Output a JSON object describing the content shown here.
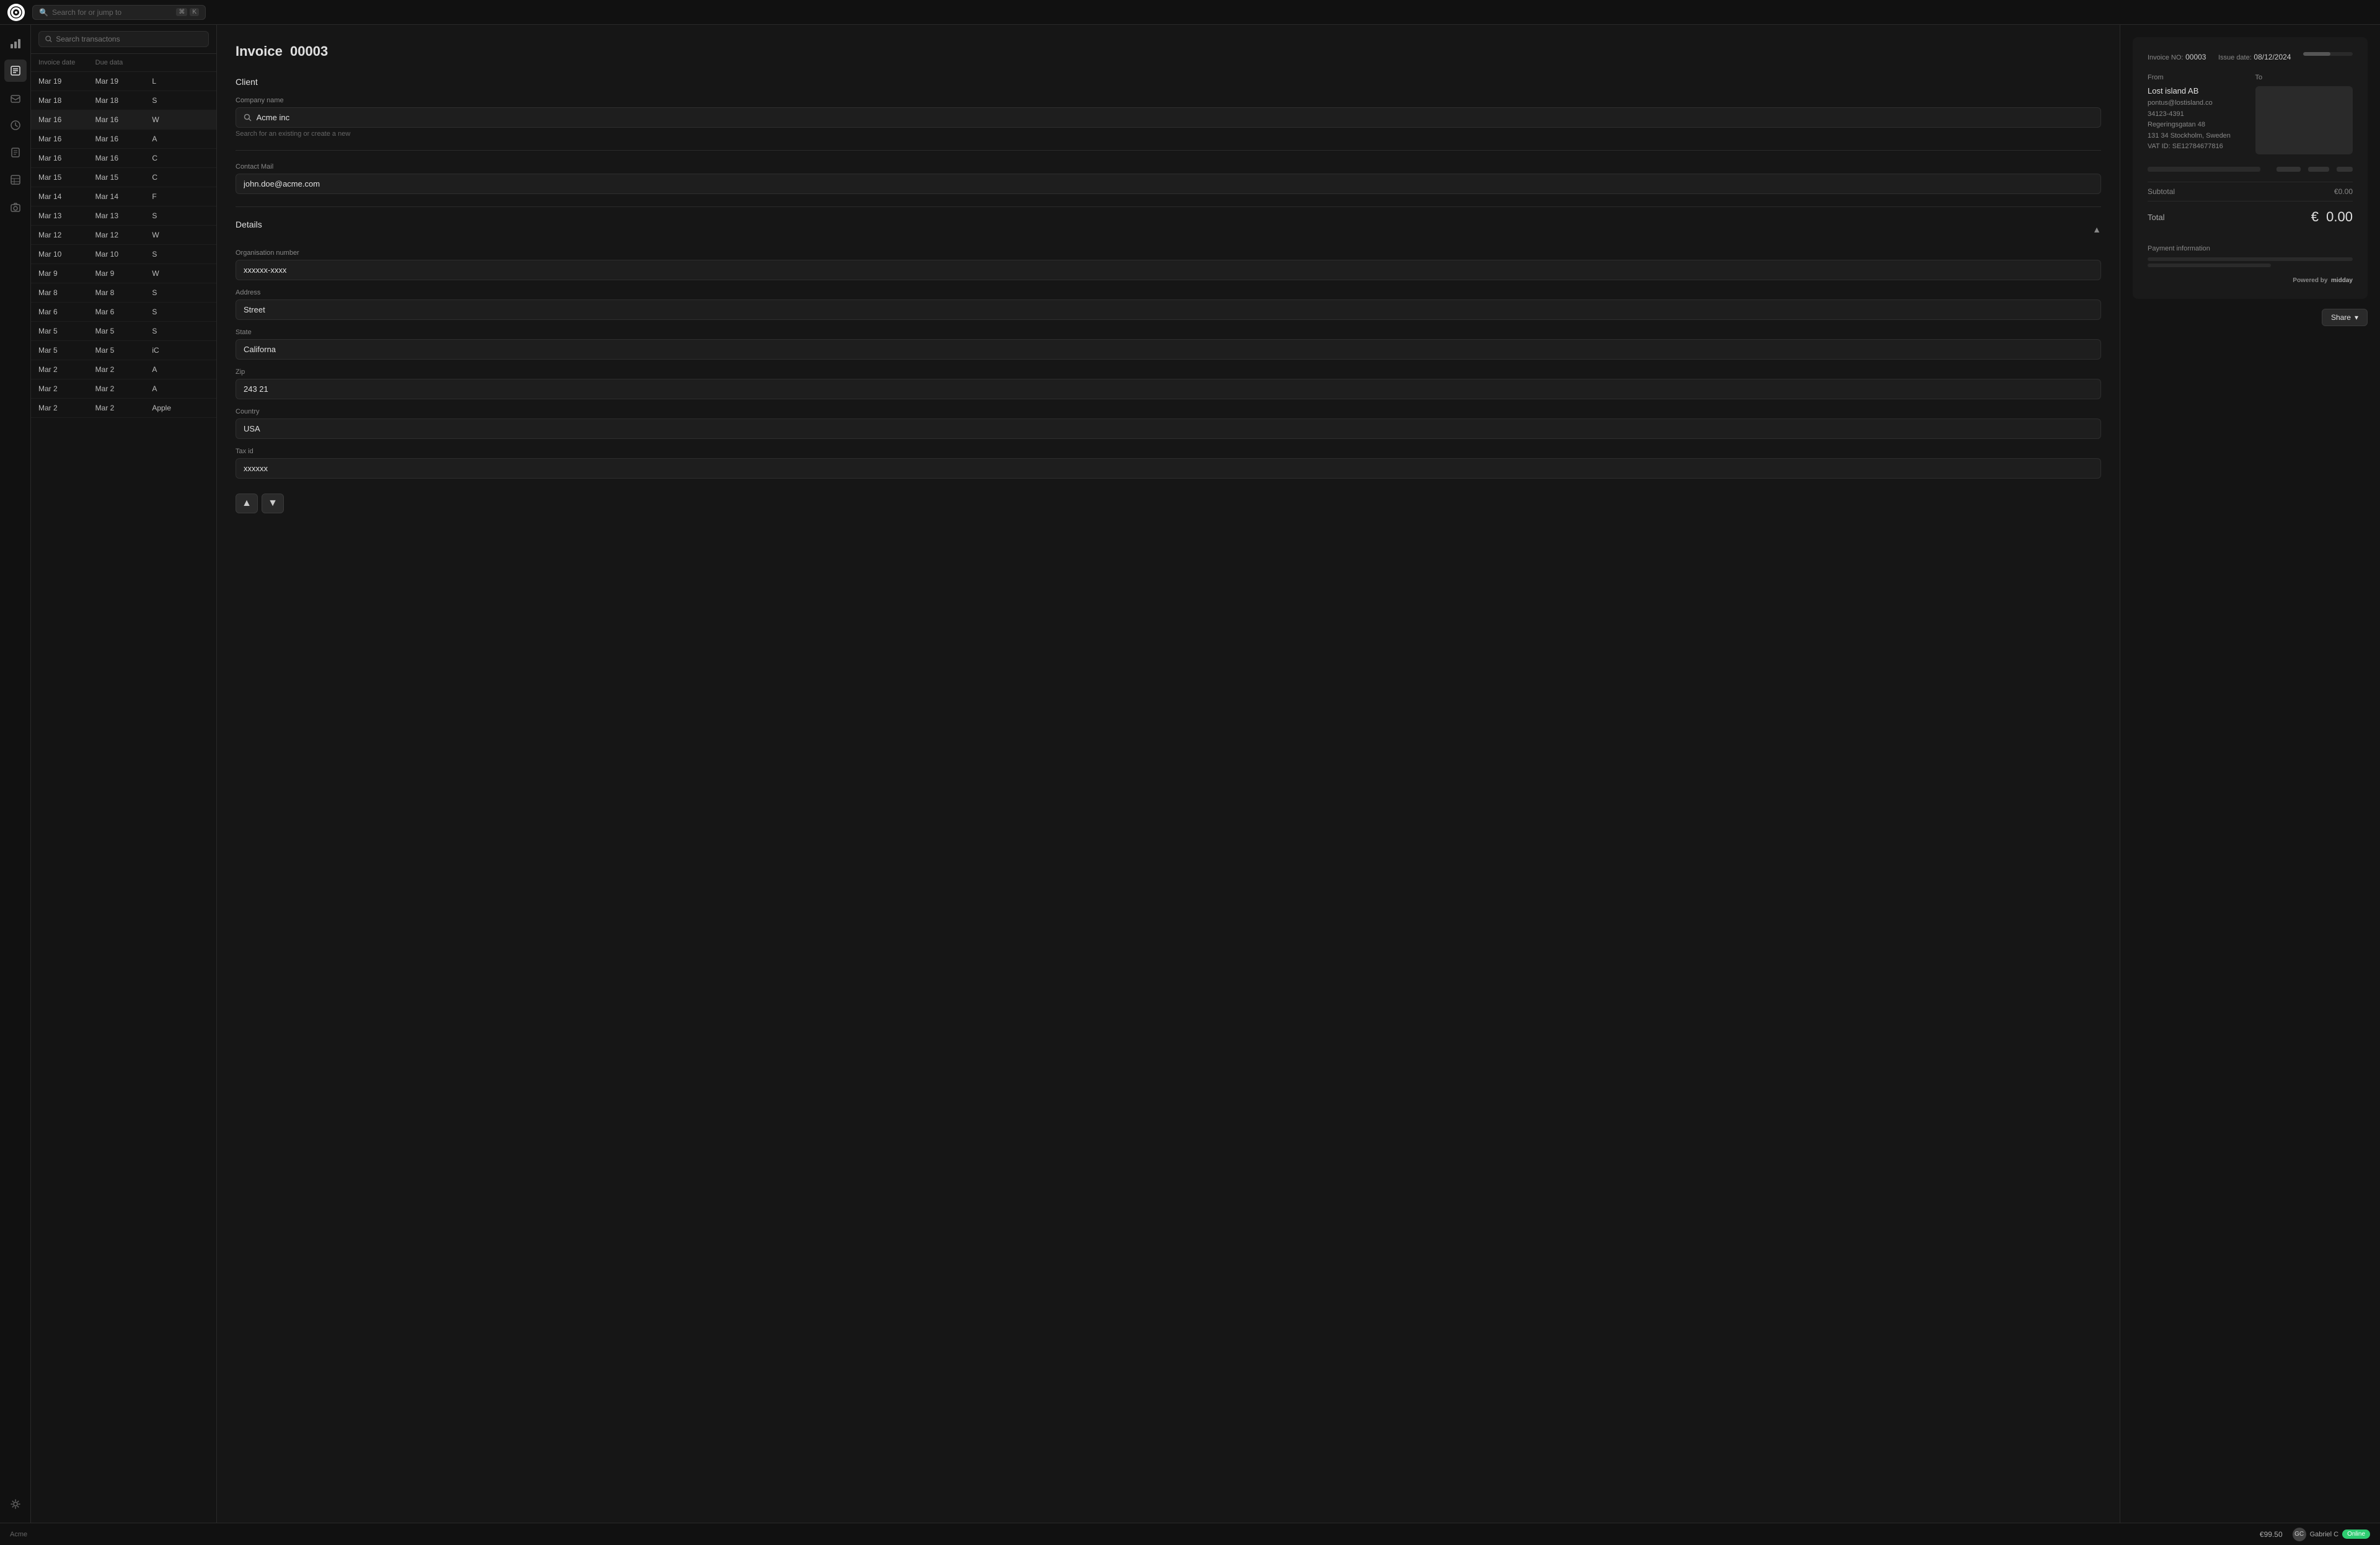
{
  "app": {
    "logo_alt": "Acme App Logo"
  },
  "topbar": {
    "search_placeholder": "Search for or jump to",
    "shortcut_cmd": "⌘",
    "shortcut_key": "K"
  },
  "sidebar": {
    "icons": [
      {
        "name": "chart-bar-icon",
        "symbol": "▦",
        "active": false
      },
      {
        "name": "invoice-icon",
        "symbol": "▤",
        "active": true
      },
      {
        "name": "inbox-icon",
        "symbol": "⊡",
        "active": false
      },
      {
        "name": "clock-icon",
        "symbol": "◷",
        "active": false
      },
      {
        "name": "document-icon",
        "symbol": "▣",
        "active": false
      },
      {
        "name": "table-icon",
        "symbol": "⊟",
        "active": false
      },
      {
        "name": "camera-icon",
        "symbol": "⊛",
        "active": false
      },
      {
        "name": "settings-icon",
        "symbol": "⚙",
        "active": false
      }
    ]
  },
  "left_panel": {
    "search_placeholder": "Search transactons",
    "table": {
      "headers": [
        "Invoice date",
        "Due data",
        ""
      ],
      "rows": [
        {
          "date": "Mar 19",
          "due": "Mar 19",
          "extra": "L"
        },
        {
          "date": "Mar 18",
          "due": "Mar 18",
          "extra": "S"
        },
        {
          "date": "Mar 16",
          "due": "Mar 16",
          "extra": "W"
        },
        {
          "date": "Mar 16",
          "due": "Mar 16",
          "extra": "A"
        },
        {
          "date": "Mar 16",
          "due": "Mar 16",
          "extra": "C"
        },
        {
          "date": "Mar 15",
          "due": "Mar 15",
          "extra": "C"
        },
        {
          "date": "Mar 14",
          "due": "Mar 14",
          "extra": "F"
        },
        {
          "date": "Mar 13",
          "due": "Mar 13",
          "extra": "S"
        },
        {
          "date": "Mar 12",
          "due": "Mar 12",
          "extra": "W"
        },
        {
          "date": "Mar 10",
          "due": "Mar 10",
          "extra": "S"
        },
        {
          "date": "Mar 9",
          "due": "Mar 9",
          "extra": "W"
        },
        {
          "date": "Mar 8",
          "due": "Mar 8",
          "extra": "S"
        },
        {
          "date": "Mar 6",
          "due": "Mar 6",
          "extra": "S"
        },
        {
          "date": "Mar 5",
          "due": "Mar 5",
          "extra": "S"
        },
        {
          "date": "Mar 5",
          "due": "Mar 5",
          "extra": "iC"
        },
        {
          "date": "Mar 2",
          "due": "Mar 2",
          "extra": "A"
        },
        {
          "date": "Mar 2",
          "due": "Mar 2",
          "extra": "A"
        },
        {
          "date": "Mar 2",
          "due": "Mar 2",
          "extra": "Apple"
        }
      ]
    }
  },
  "invoice_form": {
    "title_prefix": "Invoice",
    "title_number": "00003",
    "client_section": "Client",
    "company_name_label": "Company name",
    "company_name_value": "Acme inc",
    "company_name_hint": "Search for an existing or create a new",
    "contact_mail_label": "Contact Mail",
    "contact_mail_value": "john.doe@acme.com",
    "details_section": "Details",
    "org_number_label": "Organisation number",
    "org_number_value": "xxxxxx-xxxx",
    "address_label": "Address",
    "address_value": "Street",
    "state_label": "State",
    "state_value": "Californa",
    "zip_label": "Zip",
    "zip_value": "243 21",
    "country_label": "Country",
    "country_value": "USA",
    "tax_id_label": "Tax id",
    "tax_id_value": "xxxxxx",
    "nav_up": "▲",
    "nav_down": "▼"
  },
  "invoice_preview": {
    "invoice_no_label": "Invoice NO:",
    "invoice_no_value": "00003",
    "issue_date_label": "Issue date:",
    "issue_date_value": "08/12/2024",
    "from_label": "From",
    "to_label": "To",
    "from_company": "Lost island AB",
    "from_email": "pontus@lostisland.co",
    "from_postal": "34123-4391",
    "from_street": "Regeringsgatan 48",
    "from_city": "131 34 Stockholm, Sweden",
    "from_vat": "VAT ID: SE12784677816",
    "subtotal_label": "Subtotal",
    "subtotal_value": "€0.00",
    "total_label": "Total",
    "total_value": "€  0.00",
    "payment_info_label": "Payment information",
    "powered_by_prefix": "Powered by",
    "powered_by_brand": "midday",
    "share_label": "Share",
    "share_chevron": "▾"
  },
  "bottom_bar": {
    "workspace_name": "Acme",
    "amount": "€99.50",
    "user_name": "Gabriel C",
    "status": "Online"
  }
}
